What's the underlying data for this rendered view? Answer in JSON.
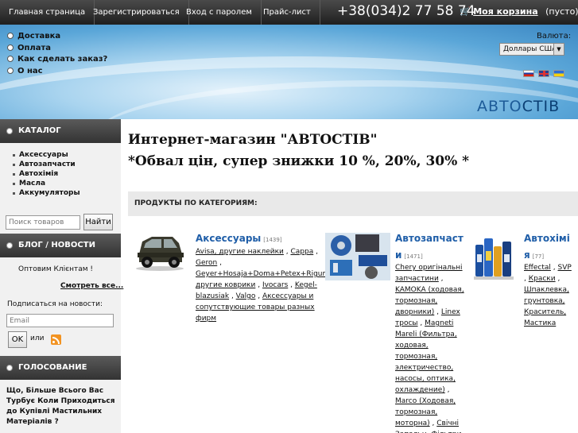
{
  "nav": {
    "items": [
      "Главная страница",
      "Зарегистрироваться",
      "Вход с паролем",
      "Прайс-лист"
    ],
    "phone": "+38(034)2 77 58 74",
    "cart_label": "Моя корзина",
    "cart_status": "(пусто)"
  },
  "info_links": [
    "Доставка",
    "Оплата",
    "Как сделать заказ?",
    "О нас"
  ],
  "currency": {
    "label": "Валюта:",
    "selected": "Доллары США"
  },
  "languages": [
    "ru",
    "en",
    "ua"
  ],
  "logo": {
    "part1": "АВТО",
    "part2": "СТІВ"
  },
  "sidebar": {
    "catalog_title": "КАТАЛОГ",
    "categories": [
      "Аксессуары",
      "Автозапчасти",
      "Автохімія",
      "Масла",
      "Аккумуляторы"
    ],
    "search_placeholder": "Поиск товаров",
    "search_button": "Найти",
    "blog_title": "БЛОГ / НОВОСТИ",
    "news_item": "Оптовим Клієнтам !",
    "news_more": "Смотреть все...",
    "subscribe_label": "Подписаться на новости:",
    "email_placeholder": "Email",
    "ok_button": "OK",
    "or_label": "или",
    "poll_title": "ГОЛОСОВАНИЕ",
    "poll_question": "Що, Більше Всього Вас Турбує Коли Приходиться до Купівлі Мастильних Матеріалів ?"
  },
  "main": {
    "title_line1": "Интернет-магазин \"АВТОСТІВ\"",
    "title_line2": "*Обвал цін, супер знижки 10 %, 20%, 30% *",
    "products_header": "ПРОДУКТЫ ПО КАТЕГОРИЯМ:",
    "products": [
      {
        "name": "Аксессуары",
        "count": "[1439]",
        "links": [
          "Avisa, другие наклейки",
          "Cappa",
          "Geron",
          "Geyer+Hosaja+Doma+Petex+Rigum другие коврики",
          "Ivocars",
          "Kegel-blazusiak",
          "Valgo",
          "Аксессуары и сопутствующие товары разных фирм"
        ]
      },
      {
        "name_line1": "Автозапчаст",
        "name_line2": "и",
        "count": "[1471]",
        "links": [
          "Chery оригінальні запчастини",
          "KAMOKA (ходовая, тормозная, дворники)",
          "Linex тросы",
          "Magneti Mareli (Фильтра, ходовая, тормозная, электричество, насосы, оптика, охлаждение)",
          "Marco (Ходовая, тормозная, моторна)",
          "Свічні Запальн. Фільтри"
        ]
      },
      {
        "name_line1": "Автохімі",
        "name_line2": "я",
        "count": "[77]",
        "links": [
          "Effectal",
          "SVP",
          "Краски",
          "Шпаклевка, грунтовка, Краситель, Мастика"
        ]
      }
    ]
  }
}
